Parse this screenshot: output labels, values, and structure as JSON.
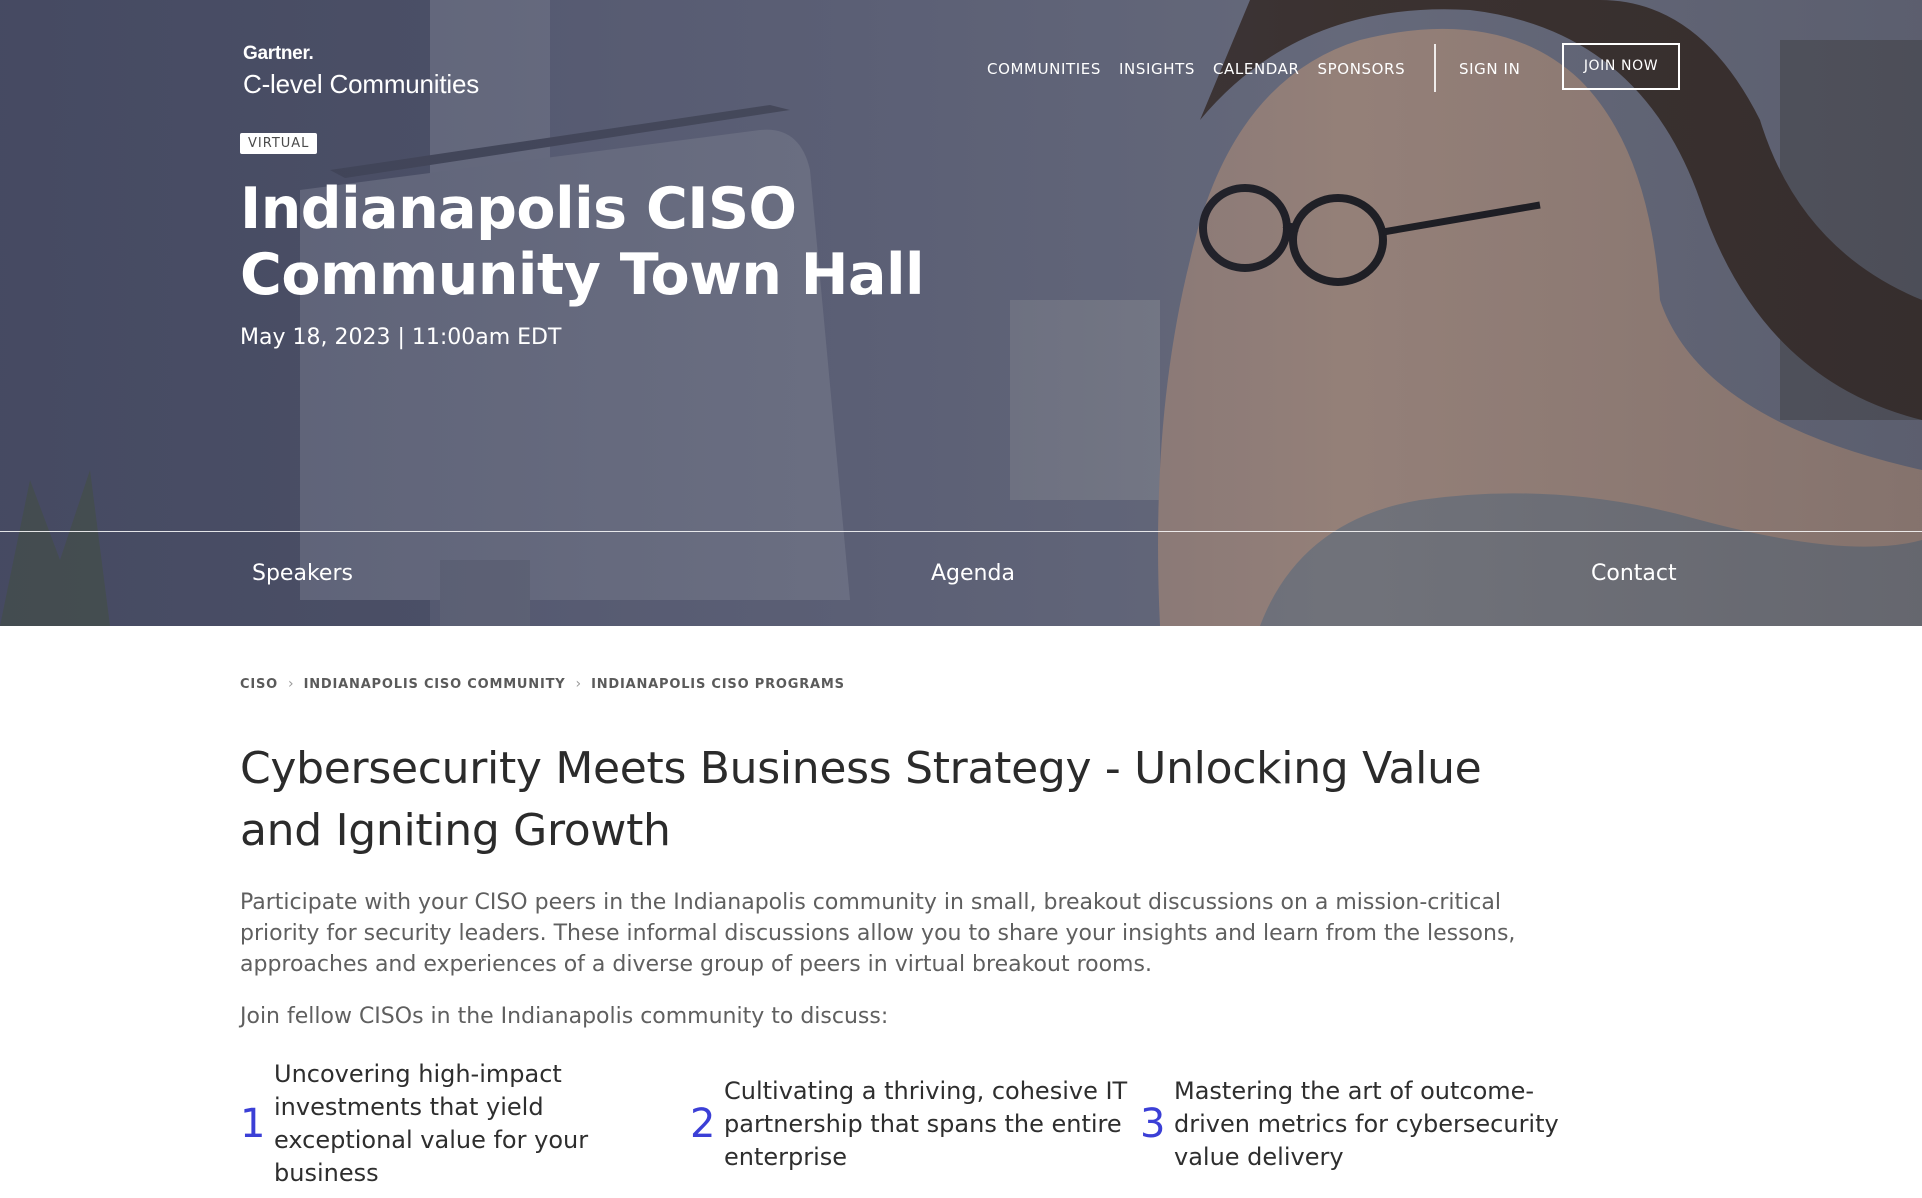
{
  "logo": {
    "brand": "Gartner.",
    "product": "C-level Communities"
  },
  "topnav": {
    "items": [
      "COMMUNITIES",
      "INSIGHTS",
      "CALENDAR",
      "SPONSORS"
    ],
    "sign_in": "SIGN IN",
    "join_now": "JOIN NOW"
  },
  "hero": {
    "tag": "VIRTUAL",
    "title": "Indianapolis CISO Community Town Hall",
    "date": "May 18, 2023 | 11:00am EDT"
  },
  "subnav": {
    "items": [
      "Speakers",
      "Agenda",
      "Contact"
    ]
  },
  "breadcrumb": [
    "CISO",
    "INDIANAPOLIS CISO COMMUNITY",
    "INDIANAPOLIS CISO PROGRAMS"
  ],
  "content": {
    "title": "Cybersecurity Meets Business Strategy - Unlocking Value and Igniting Growth",
    "intro": "Participate with your CISO peers in the Indianapolis community in small, breakout discussions on a mission-critical priority for security leaders. These informal discussions allow you to share your insights and learn from the lessons, approaches and experiences of a diverse group of peers in virtual breakout rooms.",
    "lead": "Join fellow CISOs in the Indianapolis community to discuss:",
    "points": [
      {
        "num": "1",
        "text": "Uncovering high-impact investments that yield exceptional value for your business"
      },
      {
        "num": "2",
        "text": "Cultivating a thriving, cohesive IT partnership that spans the entire enterprise"
      },
      {
        "num": "3",
        "text": "Mastering the art of outcome-driven metrics for cybersecurity value delivery"
      }
    ]
  },
  "colors": {
    "accent_number": "#3b3fd6",
    "hero_overlay": "#4b4f6a"
  }
}
